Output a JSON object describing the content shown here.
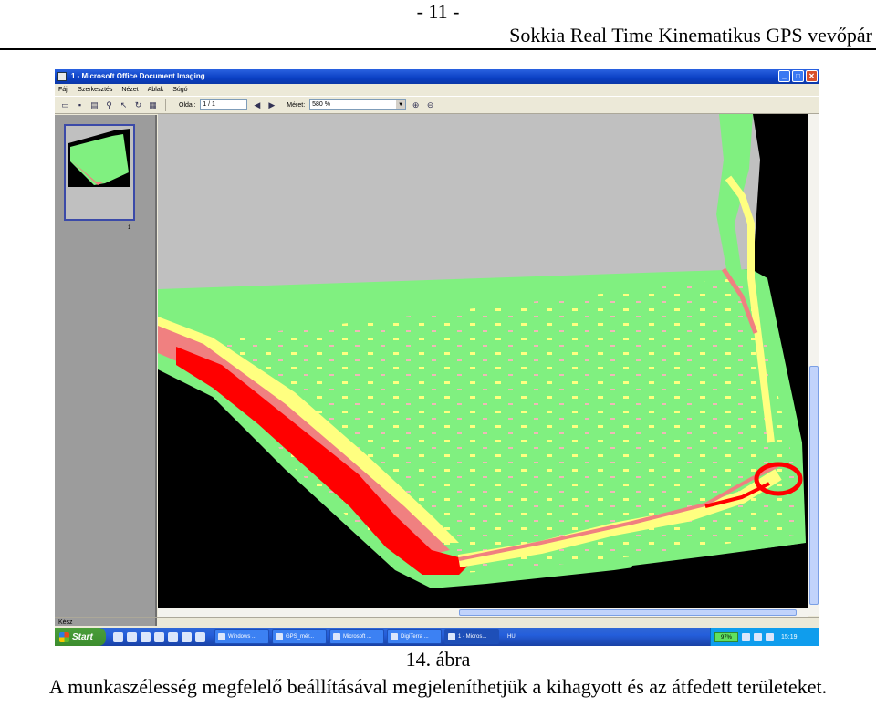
{
  "header": {
    "page_number": "- 11 -",
    "title": "Sokkia Real Time Kinematikus GPS vevőpár"
  },
  "window": {
    "title": "1 - Microsoft Office Document Imaging",
    "menu": [
      "Fájl",
      "Szerkesztés",
      "Nézet",
      "Ablak",
      "Súgó"
    ],
    "toolbar": {
      "page_label": "Oldal:",
      "page_value": "1 / 1",
      "size_label": "Méret:",
      "zoom_value": "580 %"
    },
    "thumbnail_number": "1",
    "status_text": "Kész"
  },
  "taskbar": {
    "start_label": "Start",
    "buttons": [
      "Windows ...",
      "GPS_mér...",
      "Microsoft ...",
      "DigiTerra ...",
      "1 - Micros..."
    ],
    "language": "HU",
    "battery": "97%",
    "clock": "15:19"
  },
  "colors": {
    "gray_area": "#c0c0c0",
    "covered": "#80f080",
    "edge": "#ffff80",
    "overlap": "#f08080",
    "double_overlap": "#ff0000",
    "background": "#000000"
  },
  "figure": {
    "label": "14. ábra",
    "caption": "A munkaszélesség megfelelő beállításával megjeleníthetjük a kihagyott és az átfedett területeket."
  }
}
